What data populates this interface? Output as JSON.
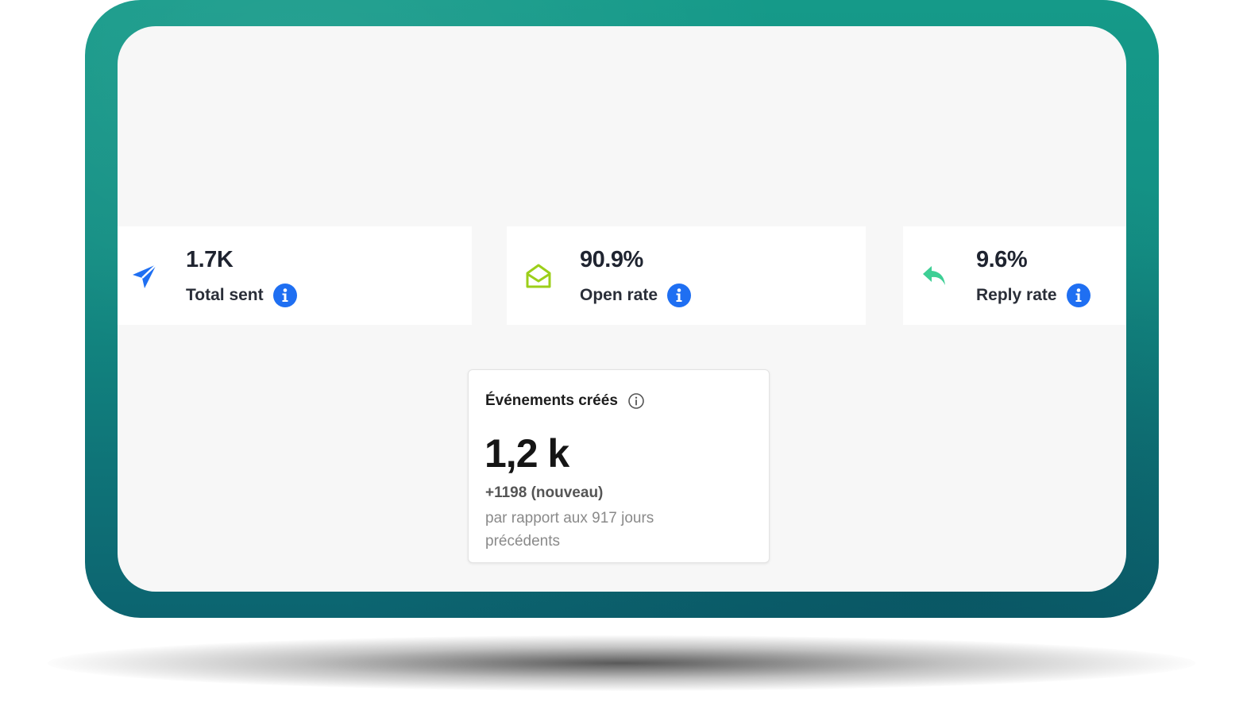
{
  "stats": [
    {
      "value": "1.7K",
      "label": "Total sent",
      "icon": "paper-plane-icon",
      "icon_color": "#1f6ff2"
    },
    {
      "value": "90.9%",
      "label": "Open rate",
      "icon": "open-envelope-icon",
      "icon_color": "#9ccf1a"
    },
    {
      "value": "9.6%",
      "label": "Reply rate",
      "icon": "reply-arrow-icon",
      "icon_color": "#3ecf95"
    }
  ],
  "event_card": {
    "title": "Événements créés",
    "value": "1,2 k",
    "delta": "+1198 (nouveau)",
    "comparison": "par rapport aux 917 jours précédents"
  },
  "colors": {
    "accent_blue": "#1f6ff2",
    "frame_teal": "#148f84"
  }
}
